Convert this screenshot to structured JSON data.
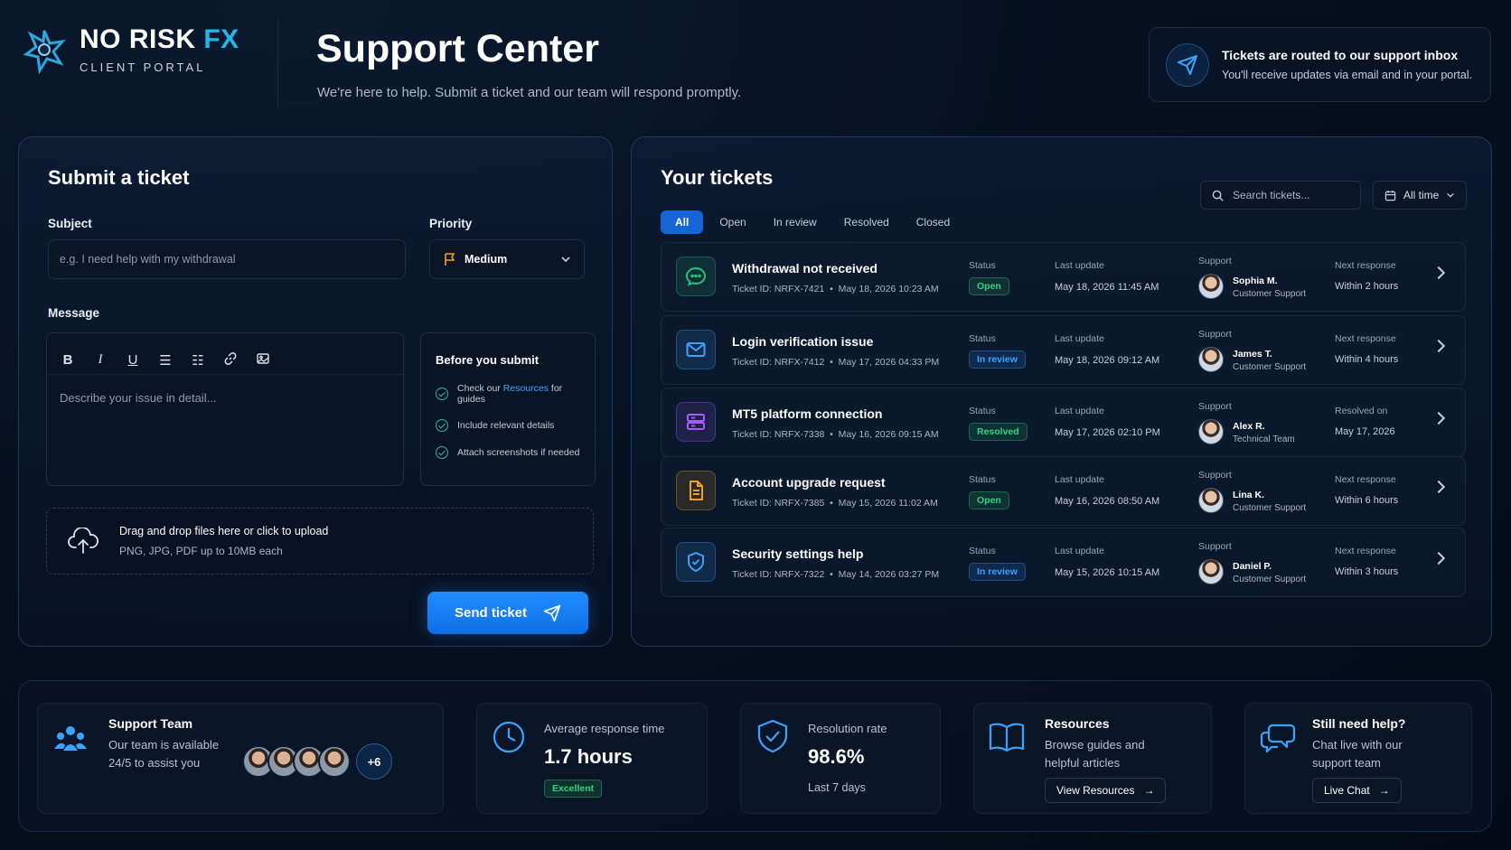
{
  "header": {
    "brand_name": "NO RISK",
    "brand_fx": "FX",
    "brand_sub": "CLIENT PORTAL",
    "title": "Support Center",
    "subtitle": "We're here to help. Submit a ticket and our team will respond promptly.",
    "notice_title": "Tickets are routed to our support inbox",
    "notice_text": "You'll receive updates via email and in your portal."
  },
  "submit": {
    "title": "Submit a ticket",
    "subject_label": "Subject",
    "subject_placeholder": "e.g. I need help with my withdrawal",
    "priority_label": "Priority",
    "priority_value": "Medium",
    "message_label": "Message",
    "message_placeholder": "Describe your issue in detail...",
    "tips_title": "Before you submit",
    "tip1_prefix": "Check our",
    "tip1_link": "Resources",
    "tip1_suffix": "for guides",
    "tip2": "Include relevant details",
    "tip3": "Attach screenshots if needed",
    "upload_title": "Drag and drop files here or click to upload",
    "upload_sub": "PNG, JPG, PDF up to 10MB each",
    "send_label": "Send ticket"
  },
  "tickets": {
    "title": "Your tickets",
    "search_placeholder": "Search tickets...",
    "filter": "All time",
    "tabs": [
      "All",
      "Open",
      "In review",
      "Resolved",
      "Closed"
    ],
    "status_label": "Status",
    "support_label": "Support",
    "items": [
      {
        "title": "Withdrawal not received",
        "id": "Ticket ID: NRFX-7421",
        "date": "May 18, 2026 10:23 AM",
        "status": "Open",
        "update_label": "Last update",
        "update": "May 18, 2026 11:45 AM",
        "agent": "Sophia M.",
        "role": "Customer Support",
        "next_label": "Next response",
        "next": "Within 2 hours",
        "icon": "chat-icon",
        "color": "#25c27a"
      },
      {
        "title": "Login verification issue",
        "id": "Ticket ID: NRFX-7412",
        "date": "May 17, 2026 04:33 PM",
        "status": "In review",
        "update_label": "Last update",
        "update": "May 18, 2026 09:12 AM",
        "agent": "James T.",
        "role": "Customer Support",
        "next_label": "Next response",
        "next": "Within 4 hours",
        "icon": "mail-icon",
        "color": "#3aa3ff"
      },
      {
        "title": "MT5 platform connection",
        "id": "Ticket ID: NRFX-7338",
        "date": "May 16, 2026 09:15 AM",
        "status": "Resolved",
        "update_label": "Last update",
        "update": "May 17, 2026 02:10 PM",
        "agent": "Alex R.",
        "role": "Technical Team",
        "next_label": "Resolved on",
        "next": "May 17, 2026",
        "icon": "server-icon",
        "color": "#a45cff"
      },
      {
        "title": "Account upgrade request",
        "id": "Ticket ID: NRFX-7385",
        "date": "May 15, 2026 11:02 AM",
        "status": "Open",
        "update_label": "Last update",
        "update": "May 16, 2026 08:50 AM",
        "agent": "Lina K.",
        "role": "Customer Support",
        "next_label": "Next response",
        "next": "Within 6 hours",
        "icon": "document-icon",
        "color": "#f0a020"
      },
      {
        "title": "Security settings help",
        "id": "Ticket ID: NRFX-7322",
        "date": "May 14, 2026 03:27 PM",
        "status": "In review",
        "update_label": "Last update",
        "update": "May 15, 2026 10:15 AM",
        "agent": "Daniel P.",
        "role": "Customer Support",
        "next_label": "Next response",
        "next": "Within 3 hours",
        "icon": "shield-check-icon",
        "color": "#3aa3ff"
      }
    ]
  },
  "bottom": {
    "team_title": "Support Team",
    "team_text1": "Our team is available",
    "team_text2": "24/5 to assist you",
    "team_more": "+6",
    "avg_label": "Average response time",
    "avg_value": "1.7 hours",
    "avg_badge": "Excellent",
    "res_label": "Resolution rate",
    "res_value": "98.6%",
    "res_period": "Last 7 days",
    "resources_title": "Resources",
    "resources_text1": "Browse guides and",
    "resources_text2": "helpful articles",
    "resources_btn": "View Resources",
    "help_title": "Still need help?",
    "help_text1": "Chat live with our",
    "help_text2": "support team",
    "help_btn": "Live Chat"
  }
}
